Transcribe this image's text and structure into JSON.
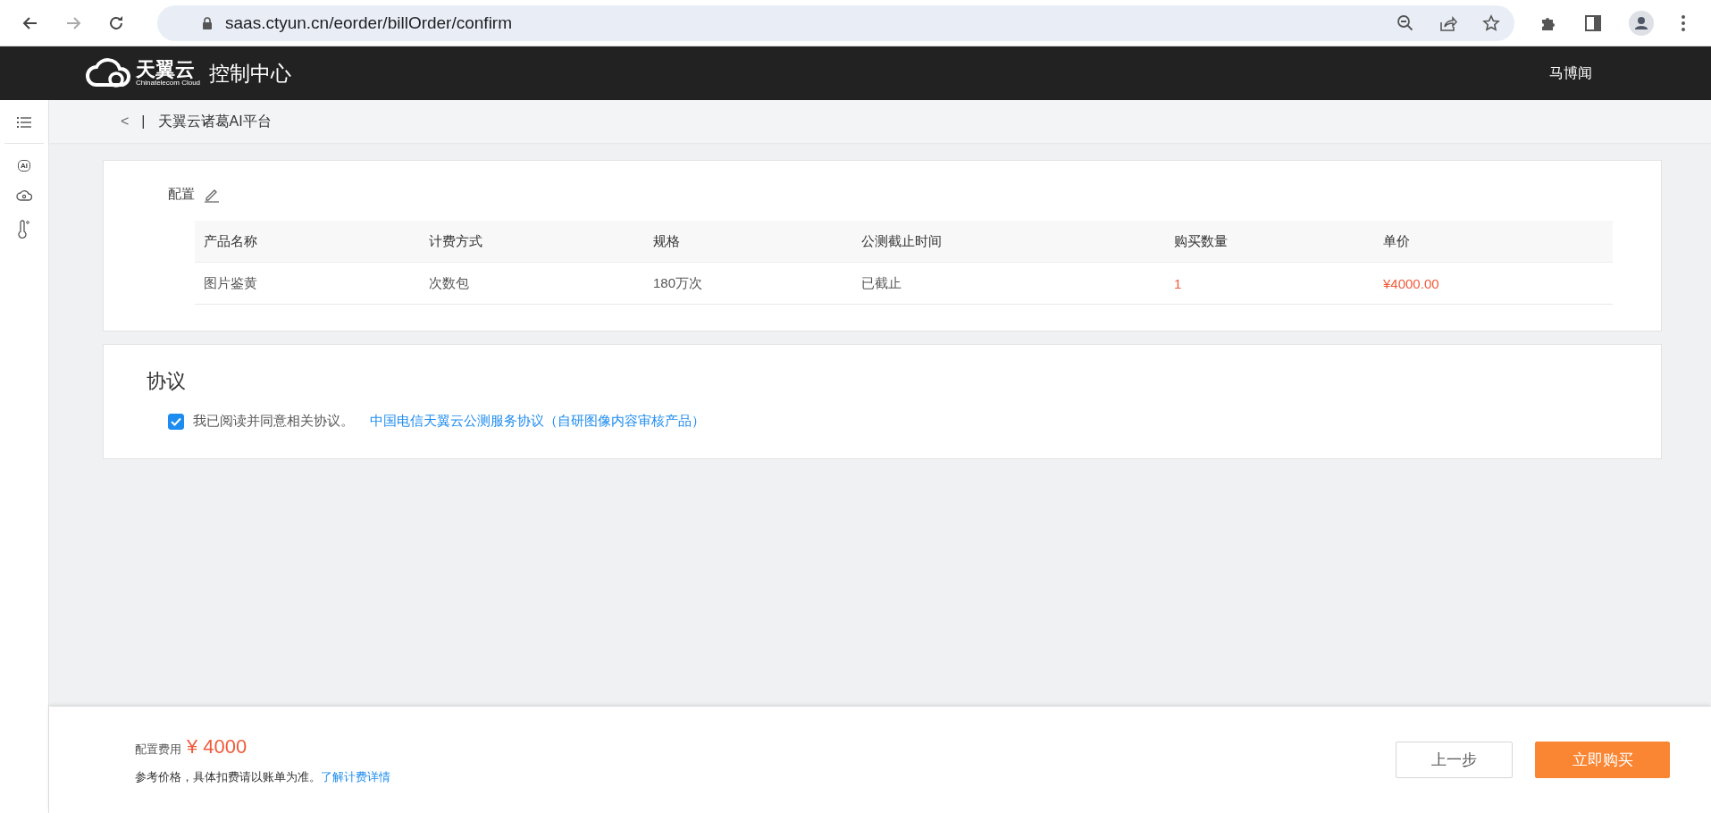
{
  "browser": {
    "url": "saas.ctyun.cn/eorder/billOrder/confirm"
  },
  "header": {
    "logo_text": "天翼云",
    "logo_subtext": "Chinatelecom Cloud",
    "title": "控制中心",
    "user": "马博闻"
  },
  "sidebar": {
    "ai_label": "AI"
  },
  "breadcrumb": {
    "back": "<",
    "separator": "|",
    "title": "天翼云诸葛AI平台"
  },
  "config": {
    "title": "配置",
    "table": {
      "columns": [
        "产品名称",
        "计费方式",
        "规格",
        "公测截止时间",
        "购买数量",
        "单价"
      ],
      "rows": [
        {
          "cells": [
            "图片鉴黄",
            "次数包",
            "180万次",
            "已截止",
            "1",
            "¥4000.00"
          ]
        }
      ]
    }
  },
  "agreement": {
    "title": "协议",
    "checked": true,
    "label": "我已阅读并同意相关协议。",
    "link": "中国电信天翼云公测服务协议（自研图像内容审核产品）"
  },
  "footer": {
    "fee_label": "配置费用",
    "fee": "¥ 4000",
    "note": "参考价格，具体扣费请以账单为准。",
    "note_link": "了解计费详情",
    "buttons": [
      {
        "label": "上一步",
        "kind": "secondary"
      },
      {
        "label": "立即购买",
        "kind": "primary"
      }
    ]
  }
}
